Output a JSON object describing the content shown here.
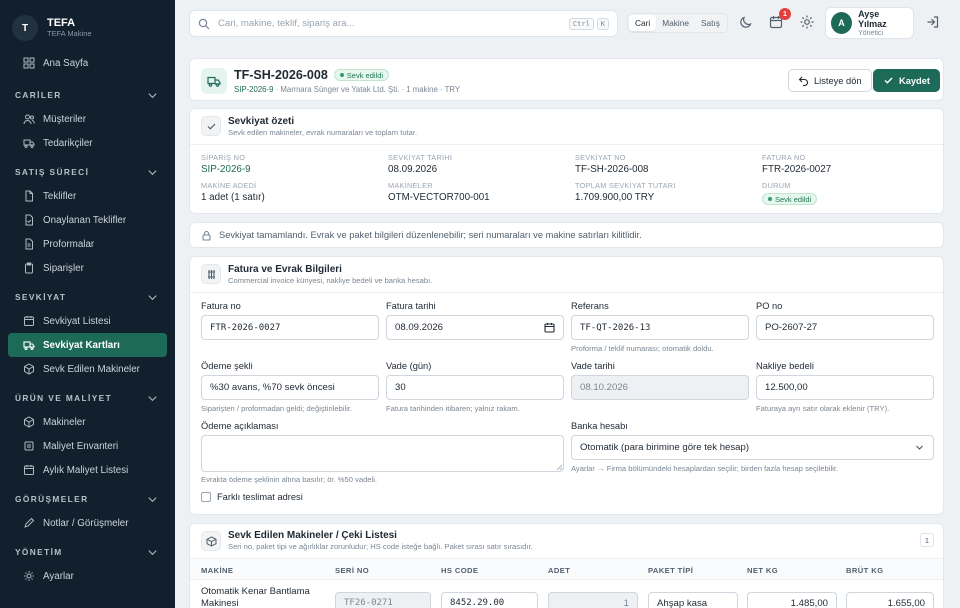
{
  "brand": {
    "logo_letter": "T",
    "title": "TEFA",
    "subtitle": "TEFA Makine"
  },
  "sidebar": {
    "home": "Ana Sayfa",
    "sections": [
      {
        "title": "CARİLER",
        "items": [
          "Müşteriler",
          "Tedarikçiler"
        ]
      },
      {
        "title": "SATIŞ SÜRECİ",
        "items": [
          "Teklifler",
          "Onaylanan Teklifler",
          "Proformalar",
          "Siparişler"
        ]
      },
      {
        "title": "SEVKİYAT",
        "items": [
          "Sevkiyat Listesi",
          "Sevkiyat Kartları",
          "Sevk Edilen Makineler"
        ]
      },
      {
        "title": "ÜRÜN VE MALİYET",
        "items": [
          "Makineler",
          "Maliyet Envanteri",
          "Aylık Maliyet Listesi"
        ]
      },
      {
        "title": "GÖRÜŞMELER",
        "items": [
          "Notlar / Görüşmeler"
        ]
      },
      {
        "title": "YÖNETİM",
        "items": [
          "Ayarlar"
        ]
      }
    ],
    "active_item": "Sevkiyat Kartları"
  },
  "topbar": {
    "search_placeholder": "Cari, makine, teklif, sipariş ara...",
    "shortcut": [
      "Ctrl",
      "K"
    ],
    "scopes": [
      "Cari",
      "Makine",
      "Satış"
    ],
    "active_scope": "Cari",
    "notification_count": "1",
    "user": {
      "initial": "A",
      "name": "Ayşe Yılmaz",
      "role": "Yönetici"
    }
  },
  "header": {
    "title": "TF-SH-2026-008",
    "status": "Sevk edildi",
    "order_link": "SIP-2026-9",
    "meta": "· Marmara Sünger ve Yatak Ltd. Şti. · 1 makine · TRY",
    "back_label": "Listeye dön",
    "save_label": "Kaydet"
  },
  "summary": {
    "title": "Sevkiyat özeti",
    "subtitle": "Sevk edilen makineler, evrak numaraları ve toplam tutar.",
    "fields": [
      {
        "label": "SİPARİŞ NO",
        "value": "SIP-2026-9"
      },
      {
        "label": "SEVKİYAT TARİHİ",
        "value": "08.09.2026"
      },
      {
        "label": "SEVKİYAT NO",
        "value": "TF-SH-2026-008"
      },
      {
        "label": "FATURA NO",
        "value": "FTR-2026-0027"
      },
      {
        "label": "MAKİNE ADEDİ",
        "value": "1 adet (1 satır)"
      },
      {
        "label": "MAKİNELER",
        "value": "OTM-VECTOR700-001"
      },
      {
        "label": "TOPLAM SEVKİYAT TUTARI",
        "value": "1.709.900,00 TRY"
      },
      {
        "label": "DURUM",
        "value": "Sevk edildi"
      }
    ]
  },
  "notice": "Sevkiyat tamamlandı. Evrak ve paket bilgileri düzenlenebilir; seri numaraları ve makine satırları kilitlidir.",
  "invoice": {
    "title": "Fatura ve Evrak Bilgileri",
    "subtitle": "Commercial invoice künyesi, nakliye bedeli ve banka hesabı.",
    "invoice_no": {
      "label": "Fatura no",
      "value": "FTR-2026-0027"
    },
    "invoice_date": {
      "label": "Fatura tarihi",
      "value": "08.09.2026"
    },
    "reference": {
      "label": "Referans",
      "value": "TF-QT-2026-13",
      "hint": "Proforma / teklif numarası; otomatik doldu."
    },
    "po_no": {
      "label": "PO no",
      "value": "PO-2607-27"
    },
    "payment_method": {
      "label": "Ödeme şekli",
      "value": "%30 avans, %70 sevk öncesi",
      "hint": "Siparişten / proformadan geldi; değiştirilebilir."
    },
    "term": {
      "label": "Vade (gün)",
      "value": "30",
      "hint": "Fatura tarihinden itibaren; yalnız rakam."
    },
    "due_date": {
      "label": "Vade tarihi",
      "value": "08.10.2026"
    },
    "freight": {
      "label": "Nakliye bedeli",
      "value": "12.500,00",
      "hint": "Faturaya ayrı satır olarak eklenir (TRY)."
    },
    "payment_note": {
      "label": "Ödeme açıklaması",
      "value": "",
      "hint": "Evrakta ödeme şeklinin altına basılır; ör. %50 vadeli."
    },
    "bank": {
      "label": "Banka hesabı",
      "value": "Otomatik (para birimine göre tek hesap)",
      "hint": "Ayarlar → Firma bölümündeki hesaplardan seçilir; birden fazla hesap seçilebilir."
    },
    "diff_address": "Farklı teslimat adresi"
  },
  "machines": {
    "title": "Sevk Edilen Makineler / Çeki Listesi",
    "subtitle": "Seri no, paket tipi ve ağırlıklar zorunludur; HS code isteğe bağlı. Paket sırası satır sırasıdır.",
    "count": "1",
    "columns": [
      "MAKİNE",
      "SERİ NO",
      "HS CODE",
      "ADET",
      "PAKET TİPİ",
      "NET KG",
      "BRÜT KG"
    ],
    "rows": [
      {
        "machine": "Otomatik Kenar Bantlama Makinesi",
        "serial": "TF26-0271",
        "hs": "8452.29.00",
        "qty": "1",
        "package": "Ahşap kasa",
        "net": "1.485,00",
        "gross": "1.655,00"
      }
    ]
  }
}
